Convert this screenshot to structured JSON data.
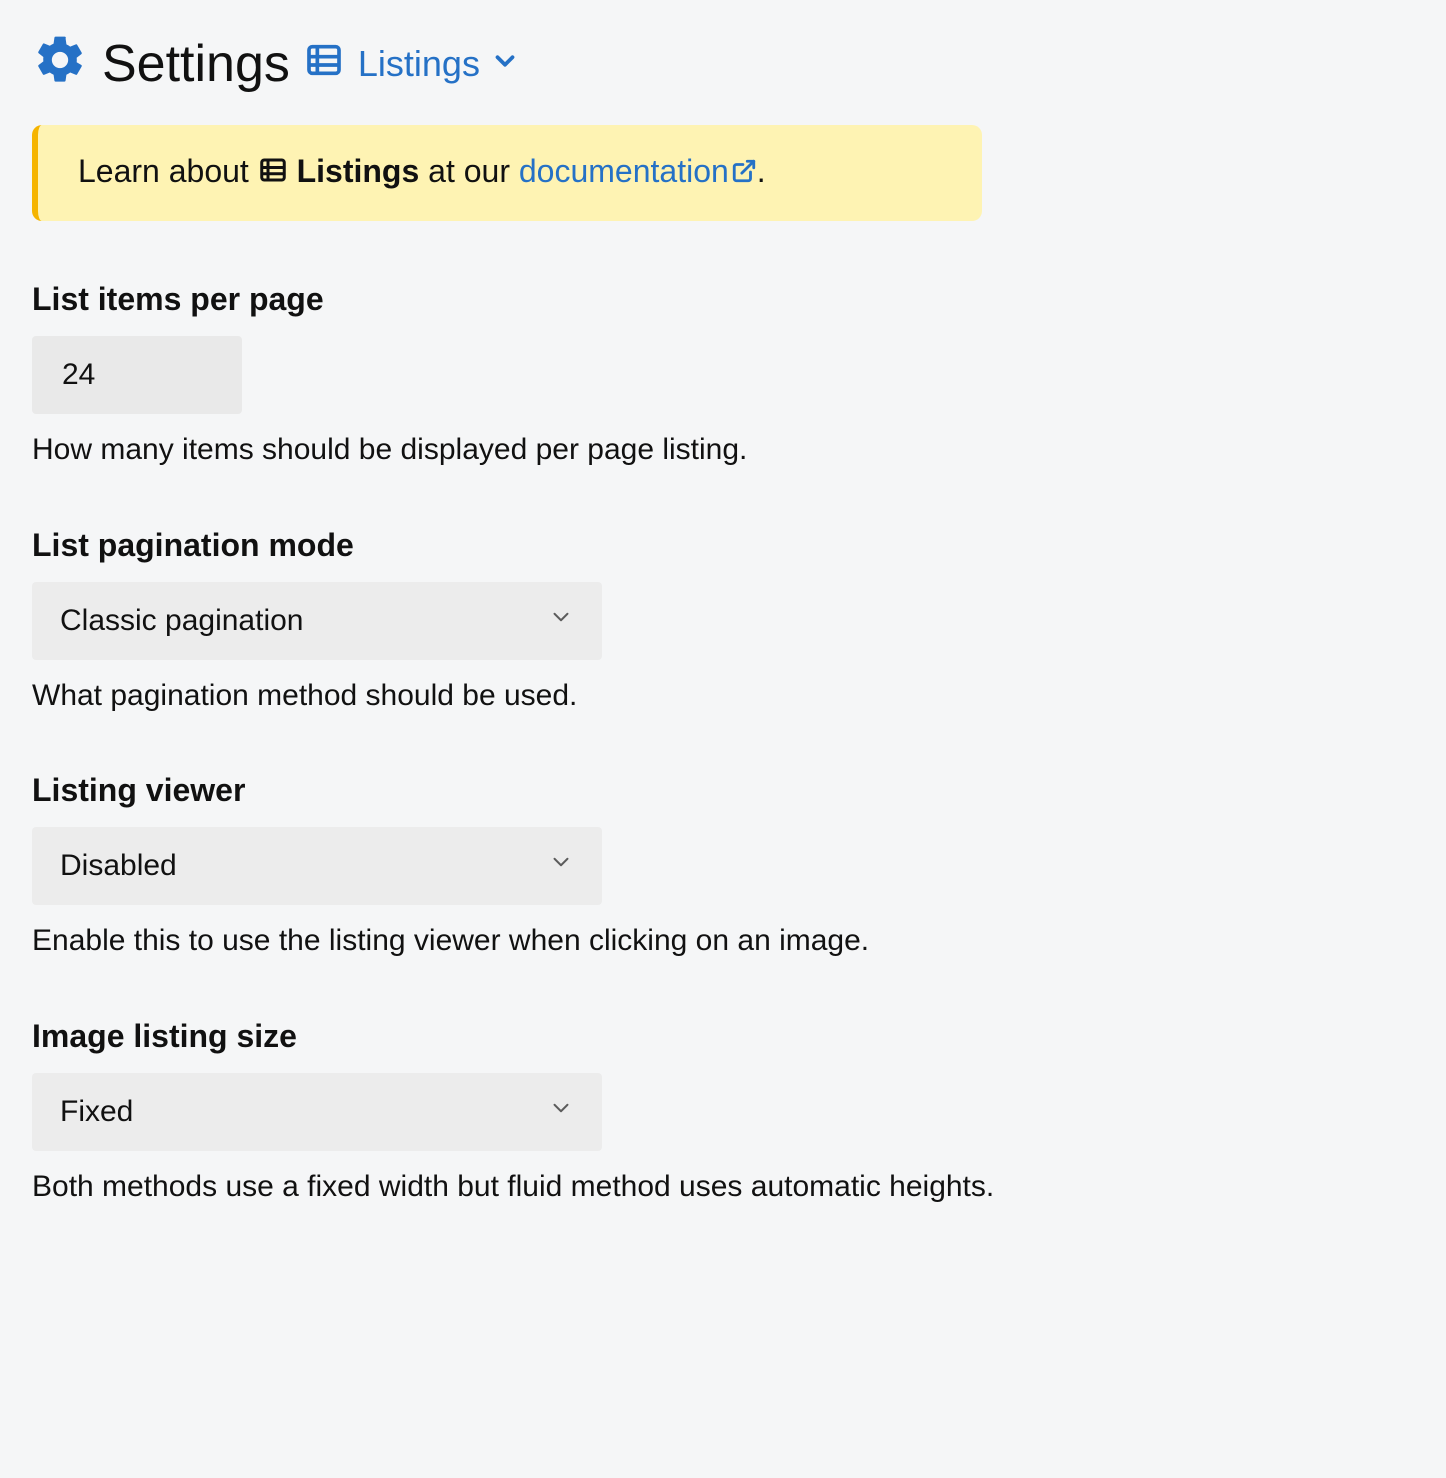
{
  "header": {
    "title": "Settings",
    "category": "Listings"
  },
  "alert": {
    "prefix": "Learn about ",
    "subject": "Listings",
    "mid": " at our ",
    "link_text": "documentation",
    "suffix": "."
  },
  "fields": {
    "items_per_page": {
      "label": "List items per page",
      "value": "24",
      "help": "How many items should be displayed per page listing."
    },
    "pagination_mode": {
      "label": "List pagination mode",
      "value": "Classic pagination",
      "help": "What pagination method should be used."
    },
    "listing_viewer": {
      "label": "Listing viewer",
      "value": "Disabled",
      "help": "Enable this to use the listing viewer when clicking on an image."
    },
    "image_listing_size": {
      "label": "Image listing size",
      "value": "Fixed",
      "help": "Both methods use a fixed width but fluid method uses automatic heights."
    }
  }
}
